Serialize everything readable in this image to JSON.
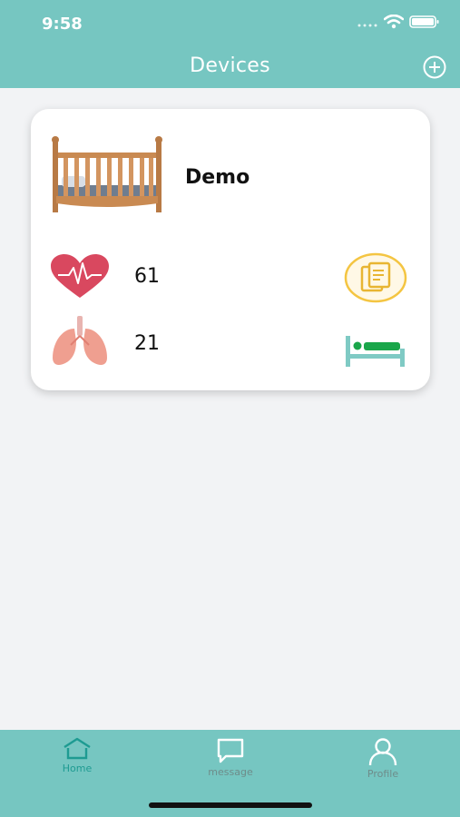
{
  "status_bar": {
    "time": "9:58",
    "signal_icon": "signal-dots-icon",
    "wifi_icon": "wifi-icon",
    "battery_icon": "battery-icon"
  },
  "header": {
    "title": "Devices",
    "add_icon": "plus-circle-icon"
  },
  "device": {
    "image_icon": "crib-icon",
    "name": "Demo",
    "heart_rate": "61",
    "respiration_rate": "21",
    "heart_icon": "heart-icon",
    "lungs_icon": "lungs-icon",
    "report_icon": "report-icon",
    "bed_icon": "bed-icon"
  },
  "tabs": [
    {
      "label": "Home",
      "icon": "home-icon",
      "active": true
    },
    {
      "label": "message",
      "icon": "message-icon",
      "active": false
    },
    {
      "label": "Profile",
      "icon": "profile-icon",
      "active": false
    }
  ],
  "colors": {
    "primary": "#76c6c1",
    "active_tab": "#1e9b92",
    "inactive_tab": "#6e8c8a",
    "heart": "#d9485f",
    "lungs": "#ef9f90",
    "report": "#f4c542",
    "bed": "#7fcac4",
    "bed_pillow": "#1aa64a"
  }
}
